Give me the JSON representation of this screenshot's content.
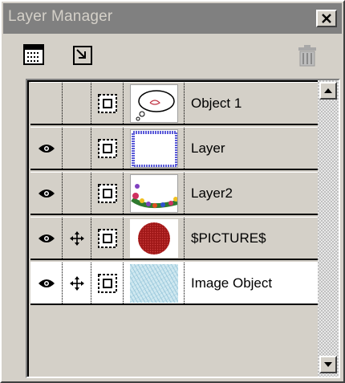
{
  "window": {
    "title": "Layer Manager",
    "close_glyph": "x"
  },
  "toolbar": {
    "new_layer_icon": "new-layer-icon",
    "resize_icon": "resize-layer-icon",
    "trash_icon": "trash-icon"
  },
  "layers": [
    {
      "name": "Object 1",
      "visible": false,
      "movable": false,
      "thumbnail": "thought-bubble-thumbnail"
    },
    {
      "name": "Layer",
      "visible": true,
      "movable": false,
      "thumbnail": "blue-frame-thumbnail"
    },
    {
      "name": "Layer2",
      "visible": true,
      "movable": false,
      "thumbnail": "flower-garland-thumbnail"
    },
    {
      "name": "$PICTURE$",
      "visible": true,
      "movable": true,
      "thumbnail": "red-ball-thumbnail"
    },
    {
      "name": "Image Object",
      "visible": true,
      "movable": true,
      "thumbnail": "blue-texture-thumbnail",
      "selected": true
    }
  ],
  "colors": {
    "face": "#d4d0c8",
    "title_bg": "#808080",
    "title_text": "#d4d0c8",
    "selected_row": "#ffffff"
  }
}
